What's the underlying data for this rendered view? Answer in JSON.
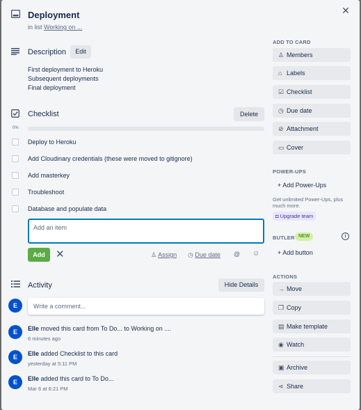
{
  "card": {
    "title": "Deployment",
    "in_list_prefix": "in list ",
    "list_name": "Working on ...",
    "close_glyph": "✕"
  },
  "description": {
    "heading": "Description",
    "edit_label": "Edit",
    "lines": [
      "First deployment to Heroku",
      "Subsequent deployments",
      "Final deployment"
    ]
  },
  "checklist": {
    "heading": "Checklist",
    "delete_label": "Delete",
    "progress_percent": "0%",
    "progress_value": 0,
    "items": [
      "Deploy to Heroku",
      "Add Cloudinary credentials (these were moved to gitignore)",
      "Add masterkey",
      "Troubleshoot",
      "Database and populate data"
    ],
    "add_item_placeholder": "Add an item",
    "add_label": "Add",
    "assign_label": "Assign",
    "due_date_label": "Due date",
    "mention_glyph": "@",
    "emoji_glyph": "☺"
  },
  "activity": {
    "heading": "Activity",
    "hide_details_label": "Hide Details",
    "comment_placeholder": "Write a comment...",
    "avatar_initial": "E",
    "entries": [
      {
        "user": "Elle",
        "text": " moved this card from To Do... to Working on ....",
        "time": "6 minutes ago"
      },
      {
        "user": "Elle",
        "text": " added Checklist to this card",
        "time": "yesterday at 5:11 PM"
      },
      {
        "user": "Elle",
        "text": " added this card to To Do...",
        "time": "Mar 6 at 6:21 PM"
      }
    ]
  },
  "sidebar": {
    "add_to_card_heading": "ADD TO CARD",
    "add_to_card": [
      {
        "label": "Members",
        "icon": "person-icon"
      },
      {
        "label": "Labels",
        "icon": "tag-icon"
      },
      {
        "label": "Checklist",
        "icon": "checkbox-icon"
      },
      {
        "label": "Due date",
        "icon": "clock-icon"
      },
      {
        "label": "Attachment",
        "icon": "paperclip-icon"
      },
      {
        "label": "Cover",
        "icon": "cover-icon"
      }
    ],
    "powerups_heading": "POWER-UPS",
    "add_powerups_label": "Add Power-Ups",
    "powerups_note": "Get unlimited Power-Ups, plus much more.",
    "upgrade_label": "Upgrade team",
    "butler_heading": "BUTLER",
    "new_badge": "NEW",
    "add_button_label": "Add button",
    "actions_heading": "ACTIONS",
    "actions": [
      {
        "label": "Move",
        "icon": "arrow-right-icon"
      },
      {
        "label": "Copy",
        "icon": "copy-icon"
      },
      {
        "label": "Make template",
        "icon": "template-icon"
      },
      {
        "label": "Watch",
        "icon": "eye-icon"
      }
    ],
    "secondary_actions": [
      {
        "label": "Archive",
        "icon": "archive-icon"
      },
      {
        "label": "Share",
        "icon": "share-icon"
      }
    ]
  },
  "colors": {
    "primary_blue": "#0079bf",
    "add_green": "#5aac44",
    "avatar_blue": "#0052cc",
    "panel_bg": "#f4f5f7"
  }
}
